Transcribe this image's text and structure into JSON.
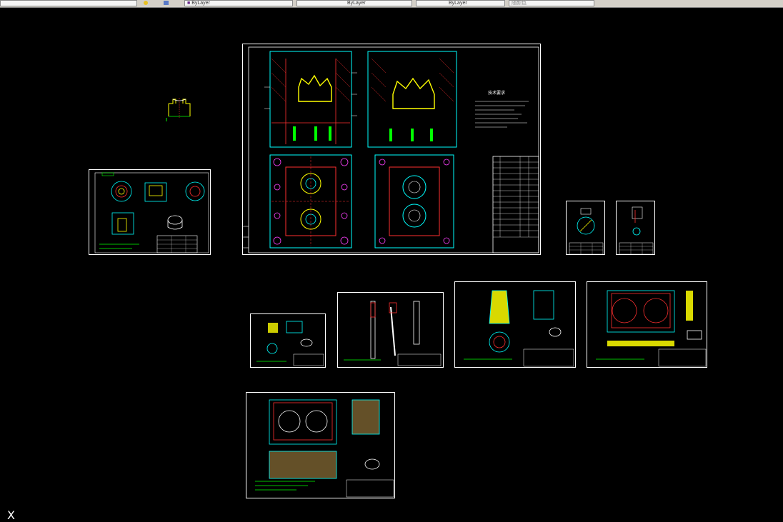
{
  "toolbar": {
    "layer_fields": [
      "ByLayer",
      "ByLayer",
      "ByLayer"
    ],
    "plot_style": "随颜色"
  },
  "colors": {
    "background": "#000000",
    "sheet_border": "#ffffff",
    "cyan": "#00ffff",
    "red": "#ff3030",
    "yellow": "#ffff00",
    "green": "#00ff00",
    "magenta": "#ff40ff",
    "blue": "#4060ff"
  },
  "drawing": {
    "tech_req_title": "技术要求",
    "ucs_label": "X"
  }
}
